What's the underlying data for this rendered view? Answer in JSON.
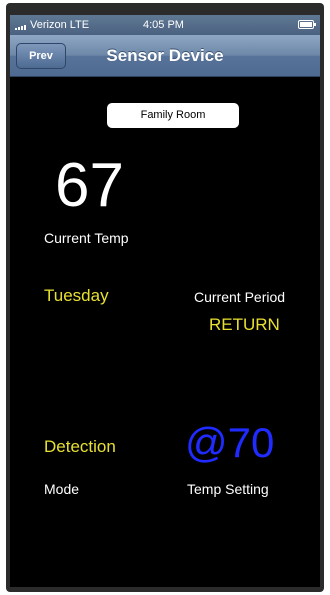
{
  "status_bar": {
    "carrier": "Verizon  LTE",
    "time": "4:05 PM",
    "icons": [
      "signal-bars-icon",
      "battery-icon"
    ]
  },
  "nav_bar": {
    "back_label": "Prev",
    "title": "Sensor Device"
  },
  "room": {
    "label": "Family Room"
  },
  "current_temp": {
    "value": "67",
    "label": "Current Temp"
  },
  "schedule": {
    "day": "Tuesday",
    "period_label": "Current Period",
    "period_value": "RETURN"
  },
  "mode": {
    "value": "Detection",
    "label": "Mode"
  },
  "temp_setting": {
    "value": "@70",
    "label": "Temp Setting"
  },
  "colors": {
    "background": "#000000",
    "accent_yellow": "#e8e030",
    "setting_blue": "#1f2bff",
    "nav_blue": "#6d87a8"
  }
}
